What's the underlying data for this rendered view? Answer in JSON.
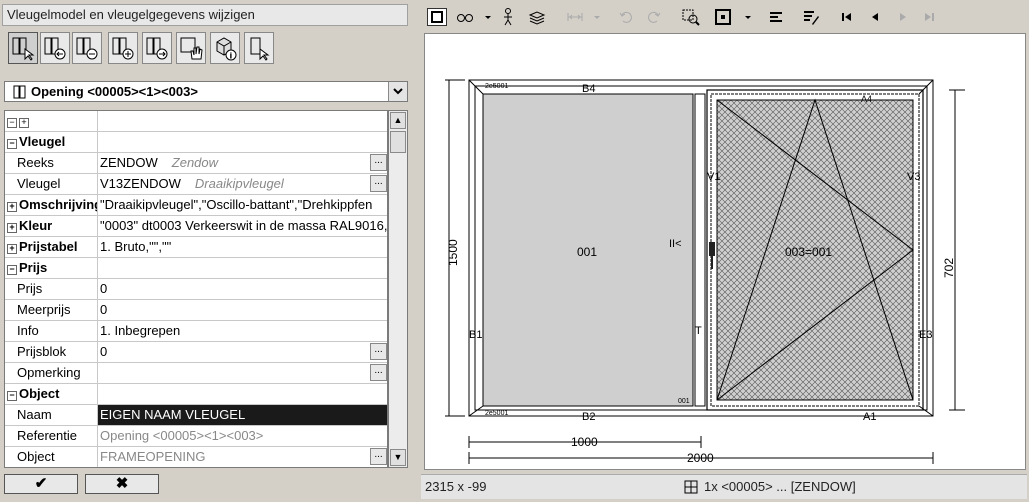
{
  "panel": {
    "title": "Vleugelmodel en vleugelgegevens wijzigen",
    "selector": "Opening <00005><1><003>",
    "ok": "✔",
    "cancel": "✖"
  },
  "properties": [
    {
      "type": "cat",
      "label": "Vleugel"
    },
    {
      "type": "prop",
      "label": "Reeks",
      "value": "ZENDOW",
      "hint": "Zendow",
      "button": true
    },
    {
      "type": "prop",
      "label": "Vleugel",
      "value": "V13ZENDOW",
      "hint": "Draaikipvleugel",
      "button": true
    },
    {
      "type": "cat",
      "label": "Omschrijving",
      "value": "\"Draaikipvleugel\",\"Oscillo-battant\",\"Drehkippfen"
    },
    {
      "type": "cat",
      "label": "Kleur",
      "value": "\"0003\" dt0003 Verkeerswit in de massa RAL9016,"
    },
    {
      "type": "cat",
      "label": "Prijstabel",
      "value": "1. Bruto,\"\",\"\""
    },
    {
      "type": "cat",
      "label": "Prijs"
    },
    {
      "type": "prop",
      "label": "Prijs",
      "value": "0"
    },
    {
      "type": "prop",
      "label": "Meerprijs",
      "value": "0"
    },
    {
      "type": "prop",
      "label": "Info",
      "value": "1. Inbegrepen"
    },
    {
      "type": "prop",
      "label": "Prijsblok",
      "value": "0",
      "button": true
    },
    {
      "type": "prop",
      "label": "Opmerking",
      "value": "",
      "button": true
    },
    {
      "type": "cat",
      "label": "Object"
    },
    {
      "type": "prop",
      "label": "Naam",
      "value": "EIGEN NAAM VLEUGEL",
      "selected": true
    },
    {
      "type": "prop",
      "label": "Referentie",
      "value": "Opening <00005><1><003>",
      "gray": true
    },
    {
      "type": "prop",
      "label": "Object",
      "value": "FRAMEOPENING",
      "gray": true,
      "button": true
    }
  ],
  "drawing": {
    "labels_top": "B4",
    "labels_bottom": "B2",
    "label_left": "B1",
    "label_right": "E3",
    "label_a1": "A1",
    "label_a4": "A4",
    "label_v1": "V1",
    "label_v3": "V3",
    "label_t": "T",
    "pane_fixed": "001",
    "pane_sash": "003=001",
    "hinge_marker": "II<",
    "dim_height": "1500",
    "dim_sash_height": "702",
    "dim_width_partial": "1000",
    "dim_width_total": "2000",
    "tag_topleft": "2e5001",
    "tag_bottomleft": "2e5001",
    "tag_fixed_br": "001"
  },
  "status": {
    "coords": "2315 x -99",
    "info": "1x <00005> ... [ZENDOW]"
  },
  "colors": {
    "selected_row": "#1a1a1a",
    "canvas_bg": "#ffffff",
    "glass_fill": "#cfcfcf"
  }
}
